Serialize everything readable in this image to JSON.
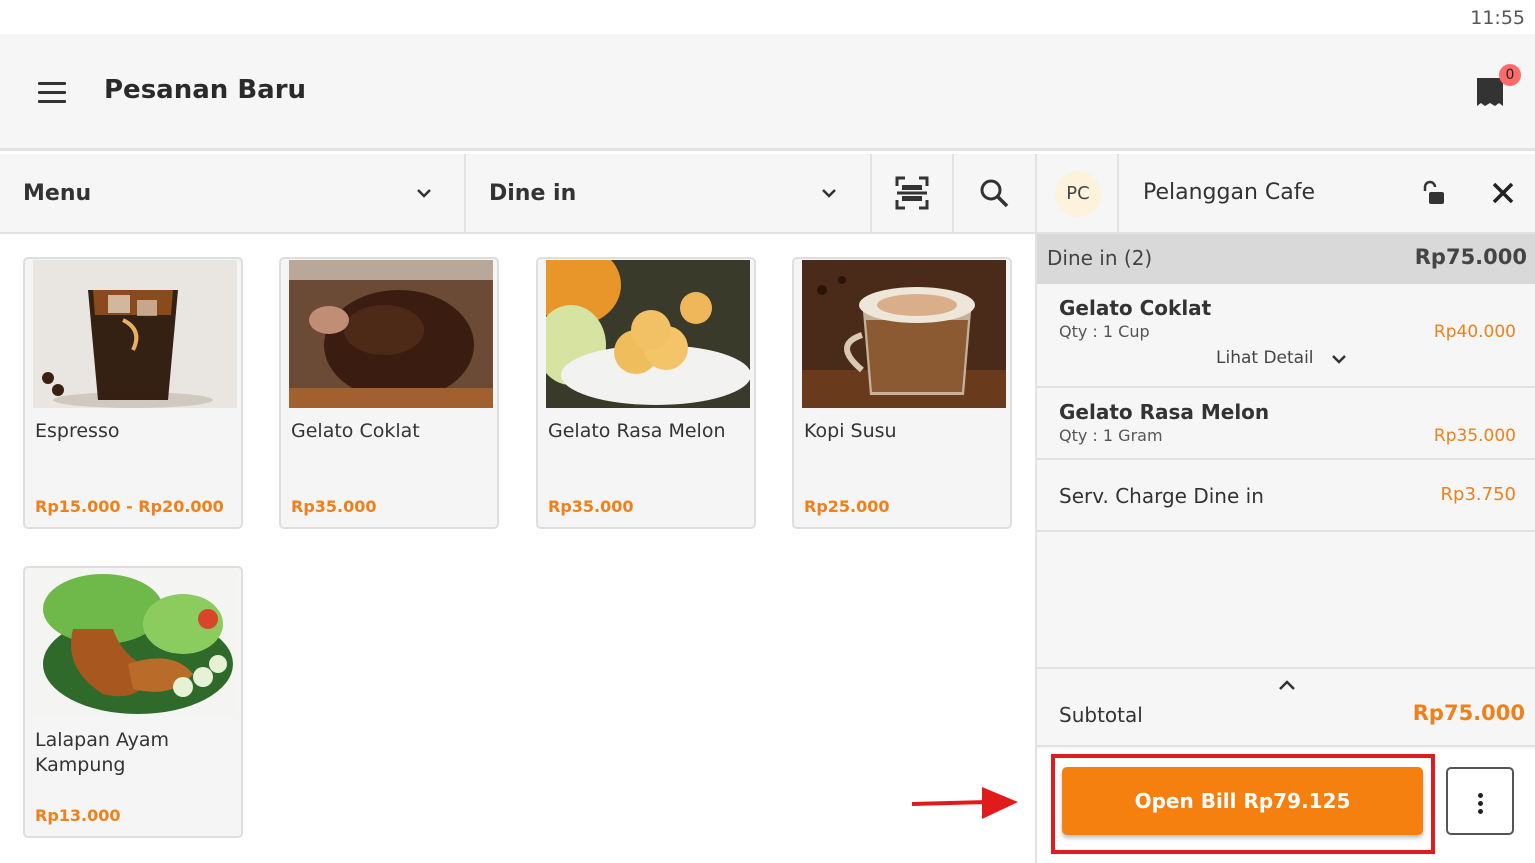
{
  "status_bar": {
    "time": "11:55"
  },
  "header": {
    "title": "Pesanan Baru",
    "bill_count": "0"
  },
  "toolbar": {
    "category": "Menu",
    "order_type": "Dine in"
  },
  "products": [
    {
      "name": "Espresso",
      "price": "Rp15.000 - Rp20.000",
      "image": "iced-espresso-photo"
    },
    {
      "name": "Gelato Coklat",
      "price": "Rp35.000",
      "image": "chocolate-gelato-photo"
    },
    {
      "name": "Gelato Rasa Melon",
      "price": "Rp35.000",
      "image": "melon-gelato-photo"
    },
    {
      "name": "Kopi Susu",
      "price": "Rp25.000",
      "image": "milk-coffee-photo"
    },
    {
      "name": "Lalapan Ayam Kampung",
      "price": "Rp13.000",
      "image": "fried-chicken-photo"
    }
  ],
  "customer": {
    "initials": "PC",
    "name": "Pelanggan Cafe"
  },
  "order": {
    "group_label": "Dine in (2)",
    "group_total": "Rp75.000",
    "items": [
      {
        "name": "Gelato Coklat",
        "qty": "Qty : 1 Cup",
        "price": "Rp40.000",
        "detail_label": "Lihat Detail"
      },
      {
        "name": "Gelato Rasa Melon",
        "qty": "Qty : 1 Gram",
        "price": "Rp35.000"
      }
    ],
    "service_charge": {
      "label": "Serv. Charge Dine in",
      "price": "Rp3.750"
    },
    "subtotal_label": "Subtotal",
    "subtotal": "Rp75.000",
    "open_bill_label": "Open Bill Rp79.125"
  },
  "colors": {
    "accent": "#f5800f",
    "price": "#f08019",
    "highlight": "#e01b1b",
    "badge": "#ff6b6b"
  }
}
